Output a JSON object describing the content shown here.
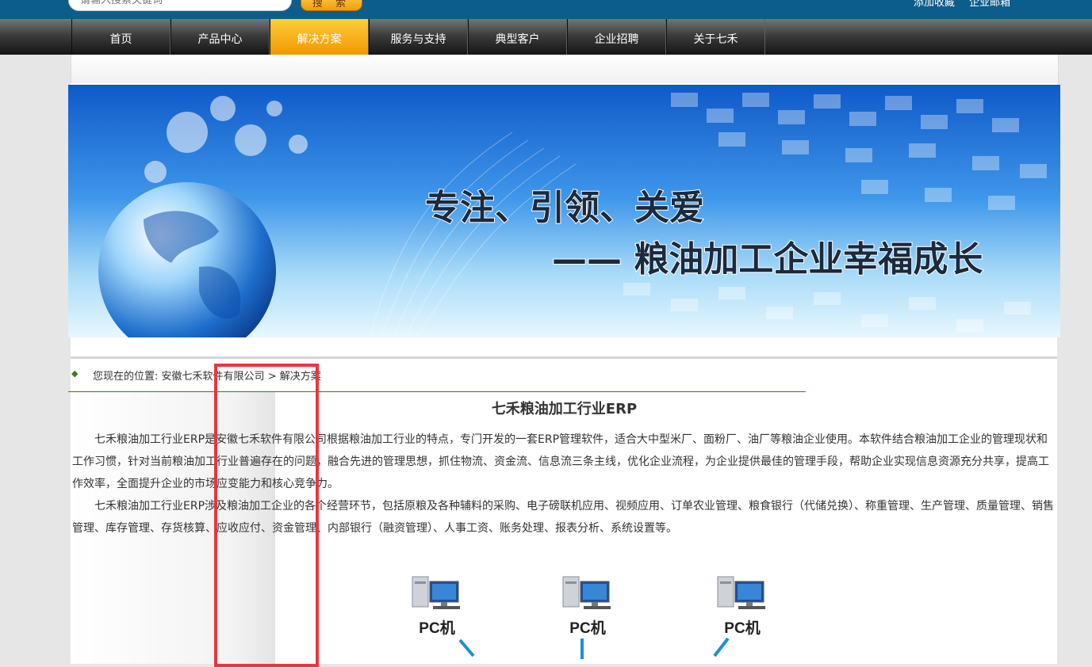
{
  "header": {
    "search_placeholder": "请输入搜索关键词",
    "search_button": "搜 索",
    "links": [
      "添加收藏",
      "企业邮箱"
    ]
  },
  "nav": {
    "items": [
      "首页",
      "产品中心",
      "解决方案",
      "服务与支持",
      "典型客户",
      "企业招聘",
      "关于七禾"
    ],
    "active": "解决方案"
  },
  "banner": {
    "line1": "专注、引领、关爱",
    "line2": "—— 粮油加工企业幸福成长"
  },
  "breadcrumb": {
    "prefix": "您现在的位置:",
    "company": "安徽七禾软件有限公司",
    "separator": ">",
    "current": "解决方案"
  },
  "article": {
    "title": "七禾粮油加工行业ERP",
    "paragraphs": [
      "七禾粮油加工行业ERP是安徽七禾软件有限公司根据粮油加工行业的特点，专门开发的一套ERP管理软件，适合大中型米厂、面粉厂、油厂等粮油企业使用。本软件结合粮油加工企业的管理现状和工作习惯，针对当前粮油加工行业普遍存在的问题，融合先进的管理思想，抓住物流、资金流、信息流三条主线，优化企业流程，为企业提供最佳的管理手段，帮助企业实现信息资源充分共享，提高工作效率，全面提升企业的市场应变能力和核心竞争力。",
      "七禾粮油加工行业ERP涉及粮油加工企业的各个经营环节，包括原粮及各种辅料的采购、电子磅联机应用、视频应用、订单农业管理、粮食银行（代储兑换）、称重管理、生产管理、质量管理、销售管理、库存管理、存货核算、应收应付、资金管理、内部银行（融资管理）、人事工资、账务处理、报表分析、系统设置等。"
    ]
  },
  "diagram": {
    "nodes": [
      "PC机",
      "PC机",
      "PC机"
    ]
  },
  "colors": {
    "header_bg": "#0d5d8c",
    "nav_active": "#f5a300",
    "highlight": "#e8373b",
    "breadcrumb_line": "#3e7a1d"
  }
}
